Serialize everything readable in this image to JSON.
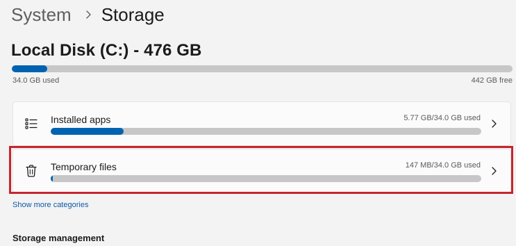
{
  "breadcrumb": {
    "parent": "System",
    "current": "Storage",
    "separator_icon": "chevron-right-icon"
  },
  "disk": {
    "title": "Local Disk (C:) - 476 GB",
    "used_label": "34.0 GB used",
    "free_label": "442 GB free",
    "used_fraction": 0.0714
  },
  "categories": [
    {
      "label": "Installed apps",
      "size": "5.77 GB/34.0 GB used",
      "fraction": 0.1697,
      "icon": "list-icon",
      "chevron_icon": "chevron-right-icon"
    },
    {
      "label": "Temporary files",
      "size": "147 MB/34.0 GB used",
      "fraction": 0.0043,
      "icon": "trash-icon",
      "chevron_icon": "chevron-right-icon"
    }
  ],
  "show_more": "Show more categories",
  "section_heading": "Storage management",
  "colors": {
    "accent": "#0063b1",
    "bar_track": "#c7c7c7",
    "highlight": "#c5252f",
    "link": "#0a5aa8"
  }
}
